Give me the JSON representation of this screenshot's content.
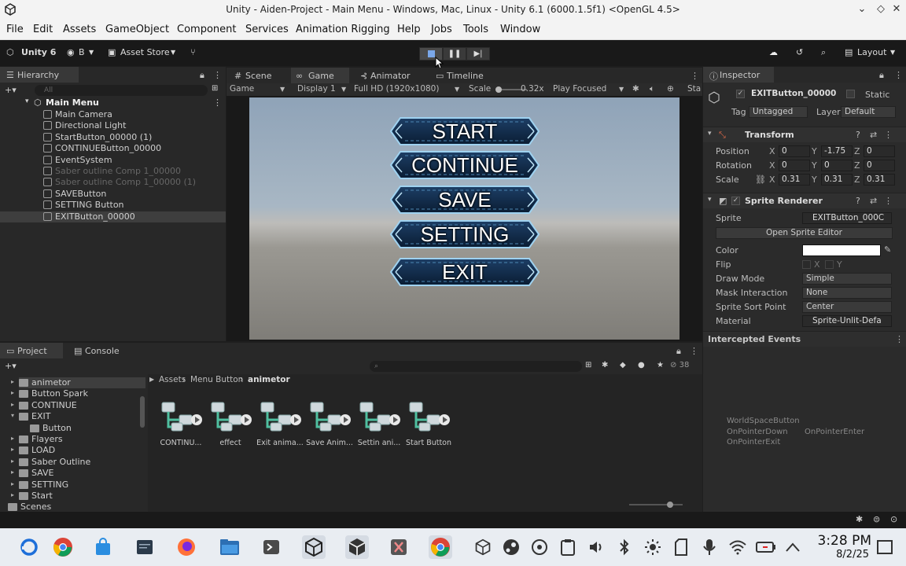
{
  "window": {
    "title": "Unity - Aiden-Project - Main Menu - Windows, Mac, Linux - Unity 6.1 (6000.1.5f1) <OpenGL 4.5>",
    "controls": [
      "chevron-down-icon",
      "maximize-icon",
      "close-icon"
    ]
  },
  "menu": [
    "File",
    "Edit",
    "Assets",
    "GameObject",
    "Component",
    "Services",
    "Animation Rigging",
    "Help",
    "Jobs",
    "Tools",
    "Window"
  ],
  "toolbar": {
    "unity": "Unity 6",
    "account": "B",
    "asset_store": "Asset Store",
    "layout": "Layout"
  },
  "hierarchy": {
    "tab": "Hierarchy",
    "search_placeholder": "All",
    "scene": "Main Menu",
    "items": [
      {
        "label": "Main Camera",
        "dim": false
      },
      {
        "label": "Directional Light",
        "dim": false
      },
      {
        "label": "StartButton_00000 (1)",
        "dim": false
      },
      {
        "label": "CONTINUEButton_00000",
        "dim": false
      },
      {
        "label": "EventSystem",
        "dim": false
      },
      {
        "label": "Saber outline Comp 1_00000",
        "dim": true
      },
      {
        "label": "Saber outline Comp 1_00000 (1)",
        "dim": true
      },
      {
        "label": "SAVEButton",
        "dim": false
      },
      {
        "label": "SETTING Button",
        "dim": false
      },
      {
        "label": "EXITButton_00000",
        "dim": false
      }
    ]
  },
  "view_tabs": [
    "Scene",
    "Game",
    "Animator",
    "Timeline"
  ],
  "gamebar": {
    "mode": "Game",
    "display": "Display 1",
    "resolution": "Full HD (1920x1080)",
    "scale_label": "Scale",
    "scale_value": "0.32x",
    "play_focused": "Play Focused",
    "stats": "Sta"
  },
  "game_buttons": [
    "START",
    "CONTINUE",
    "SAVE",
    "SETTING",
    "EXIT"
  ],
  "inspector": {
    "tab": "Inspector",
    "object_name": "EXITButton_00000",
    "static": "Static",
    "tag_label": "Tag",
    "tag": "Untagged",
    "layer_label": "Layer",
    "layer": "Default",
    "transform": {
      "title": "Transform",
      "position": {
        "label": "Position",
        "x": "0",
        "y": "-1.75",
        "z": "0"
      },
      "rotation": {
        "label": "Rotation",
        "x": "0",
        "y": "0",
        "z": "0"
      },
      "scale": {
        "label": "Scale",
        "x": "0.31",
        "y": "0.31",
        "z": "0.31"
      }
    },
    "sprite_renderer": {
      "title": "Sprite Renderer",
      "sprite_label": "Sprite",
      "sprite": "EXITButton_000C",
      "open_editor": "Open Sprite Editor",
      "color_label": "Color",
      "flip_label": "Flip",
      "flip_x": "X",
      "flip_y": "Y",
      "draw_mode_label": "Draw Mode",
      "draw_mode": "Simple",
      "mask_label": "Mask Interaction",
      "mask": "None",
      "sort_point_label": "Sprite Sort Point",
      "sort_point": "Center",
      "material_label": "Material",
      "material": "Sprite-Unlit-Defa"
    },
    "intercepted": "Intercepted Events",
    "events_title": "WorldSpaceButton",
    "events": [
      "OnPointerDown",
      "OnPointerEnter",
      "OnPointerExit"
    ]
  },
  "project": {
    "tabs": [
      "Project",
      "Console"
    ],
    "breadcrumb": [
      "Assets",
      "Menu Button",
      "animetor"
    ],
    "count": "38",
    "tree": [
      {
        "label": "animetor",
        "indent": 1,
        "selected": true
      },
      {
        "label": "Button Spark",
        "indent": 1
      },
      {
        "label": "CONTINUE",
        "indent": 1
      },
      {
        "label": "EXIT",
        "indent": 1
      },
      {
        "label": "Button",
        "indent": 2
      },
      {
        "label": "Flayers",
        "indent": 1
      },
      {
        "label": "LOAD",
        "indent": 1
      },
      {
        "label": "Saber Outline",
        "indent": 1
      },
      {
        "label": "SAVE",
        "indent": 1
      },
      {
        "label": "SETTING",
        "indent": 1
      },
      {
        "label": "Start",
        "indent": 1
      },
      {
        "label": "Scenes",
        "indent": 0
      }
    ],
    "assets": [
      "CONTINU...",
      "effect",
      "Exit anima...",
      "Save Anim...",
      "Settin ani...",
      "Start Button"
    ]
  },
  "taskbar": {
    "time": "3:28 PM",
    "date": "8/2/25"
  },
  "colors": {
    "editor_bg": "#282828",
    "accent_blue": "#3a79c8",
    "button_blue": "#0f2a4a"
  }
}
